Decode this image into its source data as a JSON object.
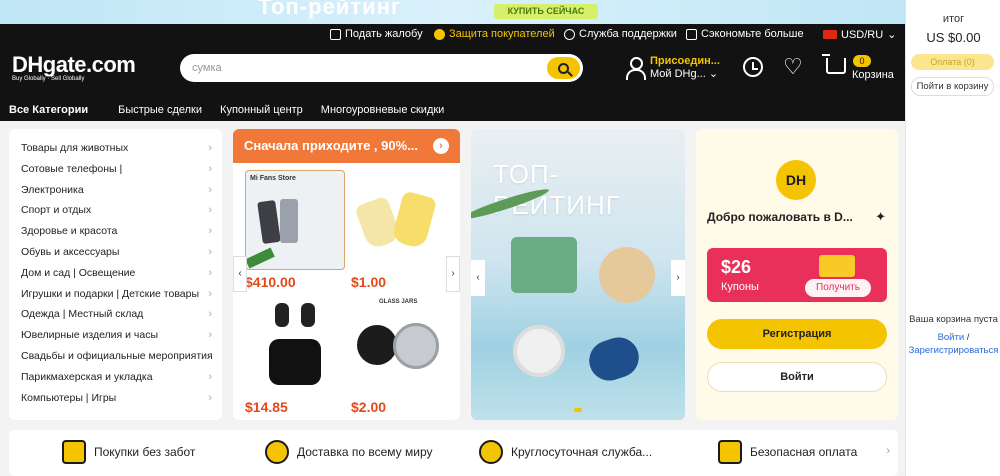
{
  "banner": {
    "title": "Топ-рейтинг",
    "cta": "КУПИТЬ СЕЙЧАС"
  },
  "topbar": {
    "complaint": "Подать жалобу",
    "protection": "Защита покупателей",
    "support": "Служба поддержки",
    "save": "Сэкономьте больше",
    "currency": "USD/RU"
  },
  "logo": {
    "name": "DHgate.com",
    "tagline": "Buy Globally · Sell Globally"
  },
  "search": {
    "placeholder": "сумка"
  },
  "account": {
    "join": "Присоедин...",
    "my": "Мой DHg..."
  },
  "cart": {
    "count": "0",
    "label": "Корзина"
  },
  "nav": [
    "Все Категории",
    "Быстрые сделки",
    "Купонный центр",
    "Многоуровневые скидки"
  ],
  "categories": [
    "Товары для животных",
    "Сотовые телефоны  |",
    "Электроника",
    "Спорт и отдых",
    "Здоровье и красота",
    "Обувь и аксессуары",
    "Дом и сад  |  Освещение",
    "Игрушки и подарки  |  Детские товары",
    "Одежда  |  Местный склад",
    "Ювелирные изделия и часы",
    "Свадьбы и официальные мероприятия",
    "Парикмахерская и укладка",
    "Компьютеры  |  Игры"
  ],
  "promo": {
    "title": "Сначала приходите , 90%...",
    "products": [
      {
        "price": "$410.00",
        "tag": "Mi Fans Store"
      },
      {
        "price": "$1.00"
      },
      {
        "price": "$14.85"
      },
      {
        "price": "$2.00",
        "tag": "GLASS JARS"
      }
    ]
  },
  "hero": {
    "title": "ТОП-РЕЙТИНГ"
  },
  "welcome": {
    "badge": "DH",
    "text": "Добро пожаловать в D...",
    "coupon_amount": "$26",
    "coupon_label": "Купоны",
    "coupon_button": "Получить",
    "register": "Регистрация",
    "login": "Войти"
  },
  "perks": [
    "Покупки без забот",
    "Доставка по всему миру",
    "Круглосуточная служба...",
    "Безопасная оплата"
  ],
  "cart_panel": {
    "label": "итог",
    "total": "US $0.00",
    "pay": "Оплата (0)",
    "go": "Пойти в корзину",
    "empty": "Ваша корзина пуста",
    "login": "Войти",
    "sep": " /",
    "register": "Зарегистрироваться"
  },
  "colors": {
    "accent": "#f5c400",
    "header": "#121212",
    "promo": "#f0793a",
    "coupon": "#e8305a",
    "price": "#e24a1c"
  }
}
